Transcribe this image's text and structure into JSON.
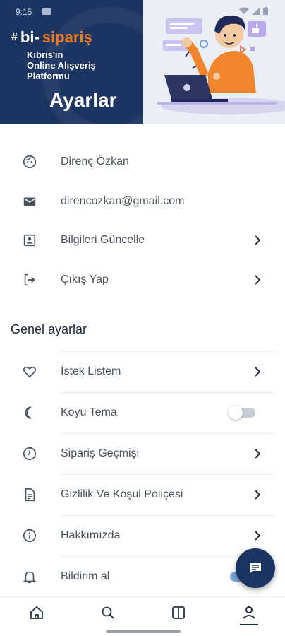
{
  "status_bar": {
    "time": "9:15"
  },
  "brand": {
    "logo_hash": "#",
    "logo_prefix": "bi-",
    "logo_name": "sipariş",
    "tagline_line1": "Kıbrıs'ın",
    "tagline_line2": "Online Alışveriş",
    "tagline_line3": "Platformu"
  },
  "page": {
    "title": "Ayarlar"
  },
  "account": {
    "name": "Direnç Özkan",
    "email": "direncozkan@gmail.com",
    "update_info": "Bilgileri Güncelle",
    "logout": "Çıkış Yap"
  },
  "general": {
    "section_title": "Genel ayarlar",
    "wishlist": "İstek Listem",
    "dark_theme": "Koyu Tema",
    "dark_theme_enabled": false,
    "order_history": "Sipariş Geçmişi",
    "privacy_policy": "Gizlilik Ve Koşul Poliçesi",
    "about": "Hakkımızda",
    "notifications": "Bildirim al",
    "notifications_enabled": true
  },
  "nav": {
    "items": [
      "home-icon",
      "search-icon",
      "catalog-icon",
      "profile-icon"
    ],
    "active": "profile-icon"
  },
  "colors": {
    "brand_navy": "#1b3461",
    "brand_orange": "#f07b1e",
    "text_muted": "#4a5260"
  }
}
